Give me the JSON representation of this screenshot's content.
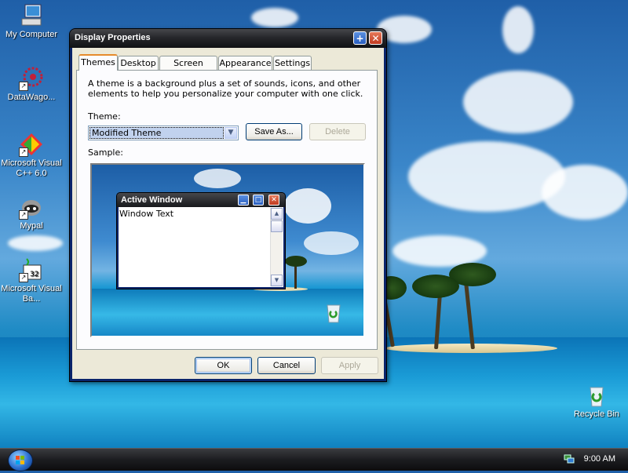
{
  "desktop": {
    "icons": [
      {
        "label": "My Computer",
        "icon": "computer-icon"
      },
      {
        "label": "DataWago...",
        "icon": "datawagon-icon"
      },
      {
        "label": "Microsoft Visual C++ 6.0",
        "icon": "visual-cpp-icon"
      },
      {
        "label": "Mypal",
        "icon": "mypal-icon"
      },
      {
        "label": "Microsoft Visual Ba...",
        "icon": "visual-basic-icon"
      },
      {
        "label": "Recycle Bin",
        "icon": "recycle-bin-icon"
      }
    ]
  },
  "window": {
    "title": "Display Properties",
    "help_icon": "+",
    "close_icon": "✕",
    "tabs": [
      "Themes",
      "Desktop",
      "Screen Saver",
      "Appearance",
      "Settings"
    ],
    "active_tab": "Themes",
    "description": "A theme is a background plus a set of sounds, icons, and other elements to help you personalize your computer with one click.",
    "theme_label": "Theme:",
    "theme_value": "Modified Theme",
    "save_as_label": "Save As...",
    "delete_label": "Delete",
    "sample_label": "Sample:",
    "preview": {
      "title": "Active Window",
      "text": "Window Text"
    },
    "ok_label": "OK",
    "cancel_label": "Cancel",
    "apply_label": "Apply"
  },
  "taskbar": {
    "clock": "9:00 AM"
  }
}
